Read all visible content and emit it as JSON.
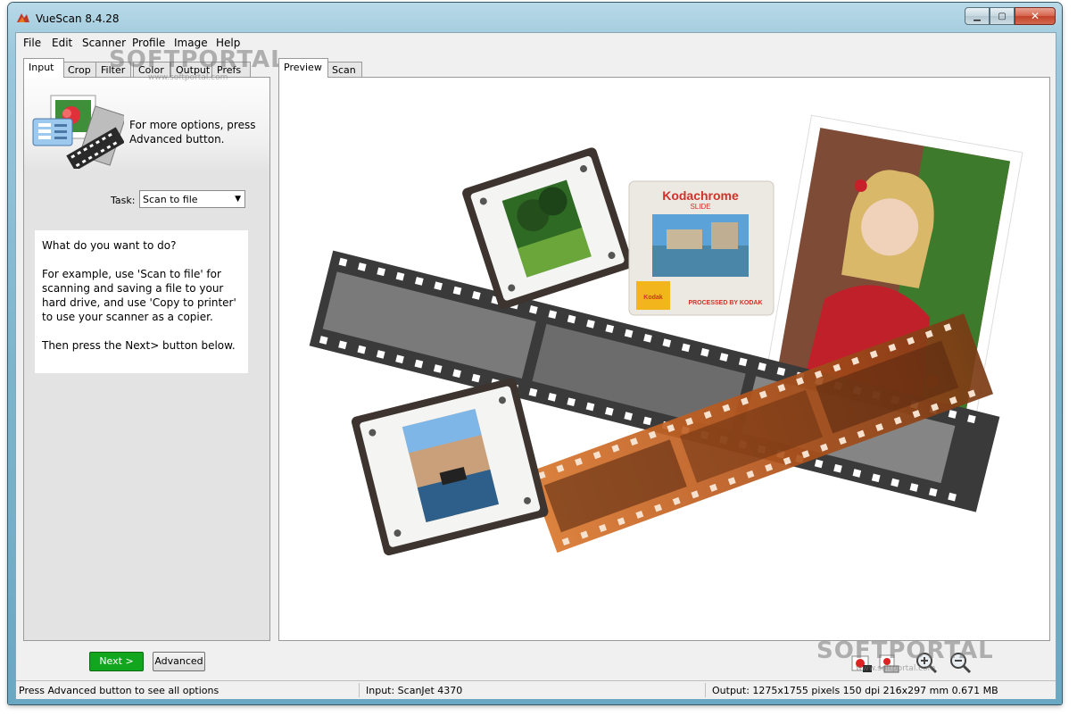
{
  "window": {
    "title": "VueScan 8.4.28",
    "buttons": [
      "minimize",
      "maximize",
      "close"
    ]
  },
  "menubar": {
    "items": [
      "File",
      "Edit",
      "Scanner",
      "Profile",
      "Image",
      "Help"
    ]
  },
  "left_tabs": {
    "items": [
      "Input",
      "Crop",
      "Filter",
      "Color",
      "Output",
      "Prefs"
    ],
    "active": "Input"
  },
  "input_panel": {
    "hint": "For more options, press Advanced button.",
    "task_label": "Task:",
    "task_value": "Scan to file",
    "help": {
      "p1": "What do you want to do?",
      "p2": "For example, use 'Scan to file' for scanning and saving a file to your hard drive, and use 'Copy to printer' to use your scanner as a copier.",
      "p3": "Then press the Next> button below."
    }
  },
  "preview_tabs": {
    "items": [
      "Preview",
      "Scan"
    ],
    "active": "Preview"
  },
  "preview_image": {
    "slide_mount_text": "Kodachrome",
    "slide_mount_subtext": "SLIDE",
    "processed_text": "PROCESSED BY KODAK",
    "logo_text": "Kodak"
  },
  "bottom_buttons": {
    "next": "Next >",
    "advanced": "Advanced"
  },
  "toolbar_icons": [
    "scan-to-file-icon",
    "scan-to-printer-icon",
    "zoom-in-icon",
    "zoom-out-icon"
  ],
  "watermark": {
    "brand": "SOFTPORTAL",
    "url": "www.softportal.com"
  },
  "statusbar": {
    "left": "Press Advanced button to see all options",
    "middle": "Input: ScanJet 4370",
    "right": "Output: 1275x1755 pixels 150 dpi 216x297 mm 0.671 MB"
  },
  "colors": {
    "next_button": "#11a61d",
    "title_bar": "#a7cfe0",
    "close_button": "#c2422a"
  }
}
